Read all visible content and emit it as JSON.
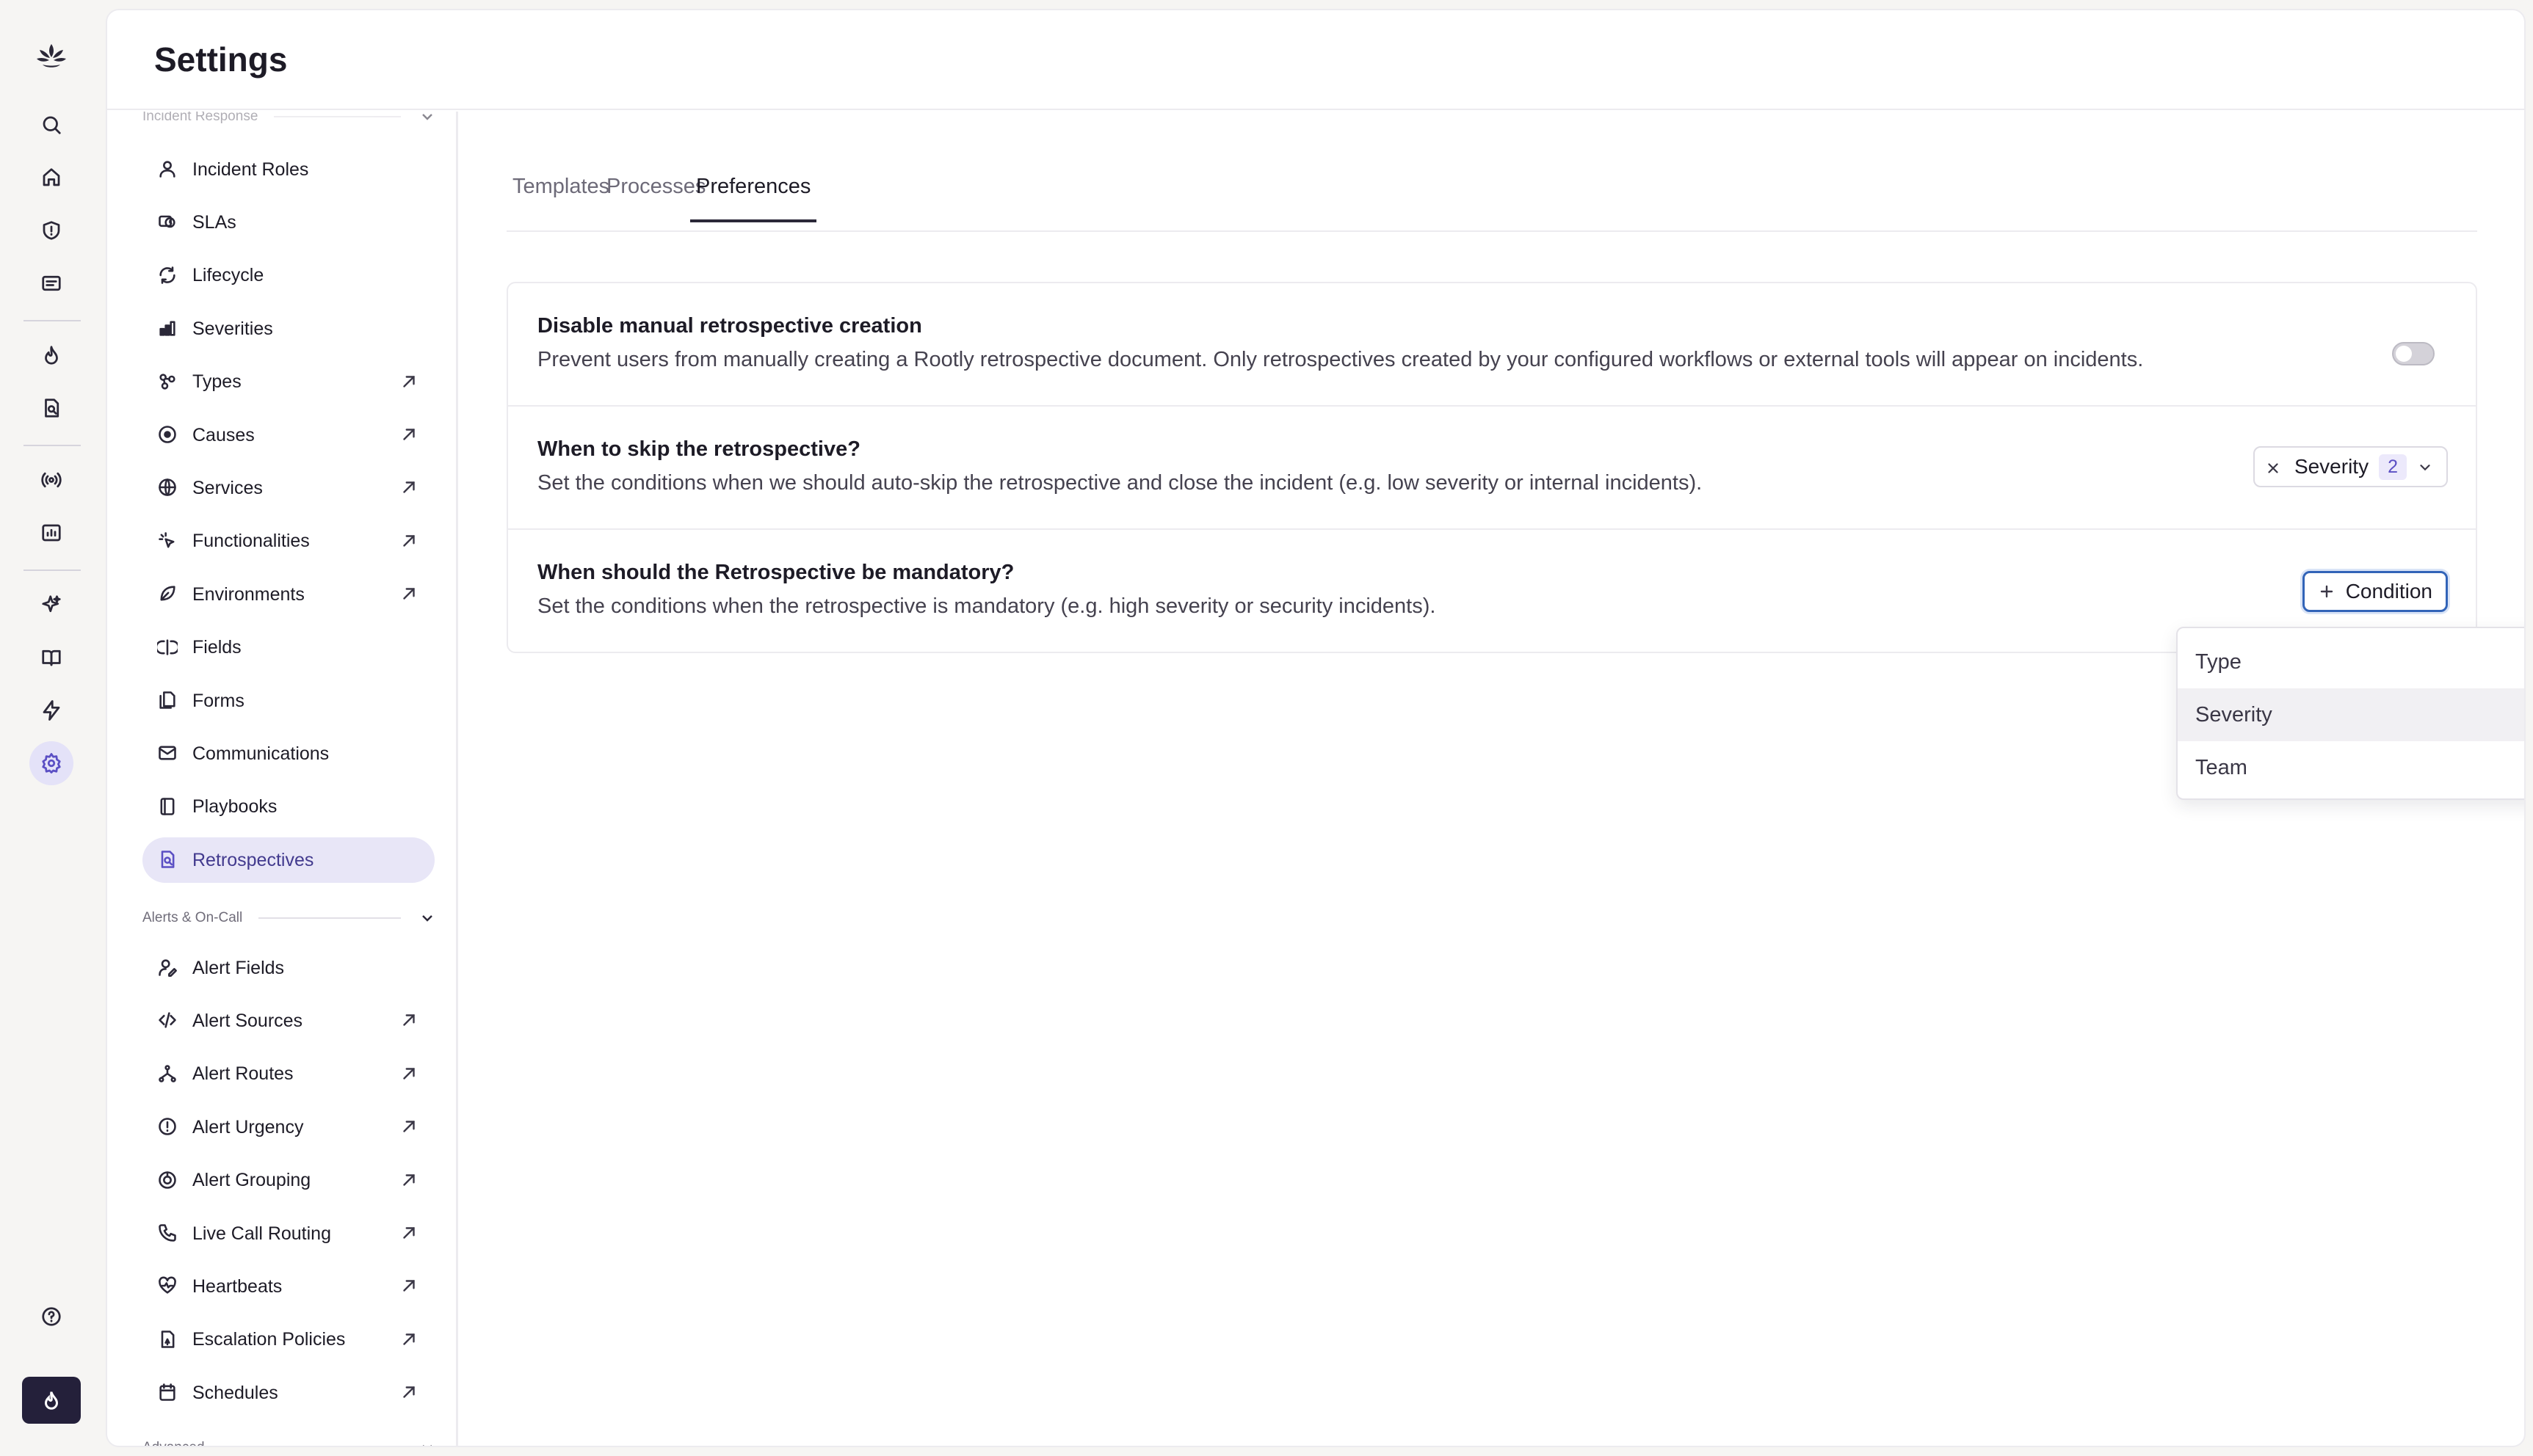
{
  "header": {
    "title": "Settings"
  },
  "rail": {
    "icons": [
      "logo-icon",
      "search-icon",
      "home-icon",
      "incidents-icon",
      "retros-icon",
      "fire-icon",
      "reports-icon",
      "broadcast-icon",
      "analytics-icon",
      "ai-sparkle-icon",
      "book-icon",
      "bolt-icon",
      "gear-icon",
      "help-icon",
      "rootly-flame-icon"
    ]
  },
  "sidebar": {
    "section_incident": "Incident Response",
    "section_alerts": "Alerts & On-Call",
    "section_advanced": "Advanced",
    "incident_items": [
      {
        "label": "Incident Roles",
        "icon": "person-icon",
        "external": false
      },
      {
        "label": "SLAs",
        "icon": "sla-timer-icon",
        "external": false
      },
      {
        "label": "Lifecycle",
        "icon": "cycle-icon",
        "external": false
      },
      {
        "label": "Severities",
        "icon": "signal-bars-icon",
        "external": false
      },
      {
        "label": "Types",
        "icon": "types-icon",
        "external": true
      },
      {
        "label": "Causes",
        "icon": "target-icon",
        "external": true
      },
      {
        "label": "Services",
        "icon": "globe-icon",
        "external": true
      },
      {
        "label": "Functionalities",
        "icon": "cursor-click-icon",
        "external": true
      },
      {
        "label": "Environments",
        "icon": "leaf-icon",
        "external": true
      },
      {
        "label": "Fields",
        "icon": "fields-icon",
        "external": false
      },
      {
        "label": "Forms",
        "icon": "forms-icon",
        "external": false
      },
      {
        "label": "Communications",
        "icon": "envelope-icon",
        "external": false
      },
      {
        "label": "Playbooks",
        "icon": "book-icon",
        "external": false
      },
      {
        "label": "Retrospectives",
        "icon": "doc-search-icon",
        "external": false
      }
    ],
    "alert_items": [
      {
        "label": "Alert Fields",
        "icon": "person-edit-icon",
        "external": false
      },
      {
        "label": "Alert Sources",
        "icon": "code-icon",
        "external": true
      },
      {
        "label": "Alert Routes",
        "icon": "route-icon",
        "external": true
      },
      {
        "label": "Alert Urgency",
        "icon": "alert-circle-icon",
        "external": true
      },
      {
        "label": "Alert Grouping",
        "icon": "grouping-icon",
        "external": true
      },
      {
        "label": "Live Call Routing",
        "icon": "phone-icon",
        "external": true
      },
      {
        "label": "Heartbeats",
        "icon": "heartbeat-icon",
        "external": true
      },
      {
        "label": "Escalation Policies",
        "icon": "escalation-icon",
        "external": true
      },
      {
        "label": "Schedules",
        "icon": "calendar-icon",
        "external": true
      }
    ]
  },
  "tabs": [
    "Templates",
    "Processes",
    "Preferences"
  ],
  "active_tab": "Preferences",
  "preferences": {
    "disable_manual": {
      "title": "Disable manual retrospective creation",
      "description": "Prevent users from manually creating a Rootly retrospective document. Only retrospectives created by your configured workflows or external tools will appear on incidents.",
      "enabled": false
    },
    "skip": {
      "title": "When to skip the retrospective?",
      "description": "Set the conditions when we should auto-skip the retrospective and close the incident (e.g. low severity or internal incidents).",
      "condition_label": "Severity",
      "condition_count": "2"
    },
    "mandatory": {
      "title": "When should the Retrospective be mandatory?",
      "description": "Set the conditions when the retrospective is mandatory (e.g. high severity or security incidents).",
      "button_label": "Condition"
    }
  },
  "dropdown": {
    "options": [
      "Type",
      "Severity",
      "Team"
    ],
    "highlighted": "Severity"
  },
  "colors": {
    "accent": "#5b4fc4",
    "focus_border": "#3264b8",
    "active_bg": "#e8e6f7",
    "rail_bottom": "#24203a"
  }
}
